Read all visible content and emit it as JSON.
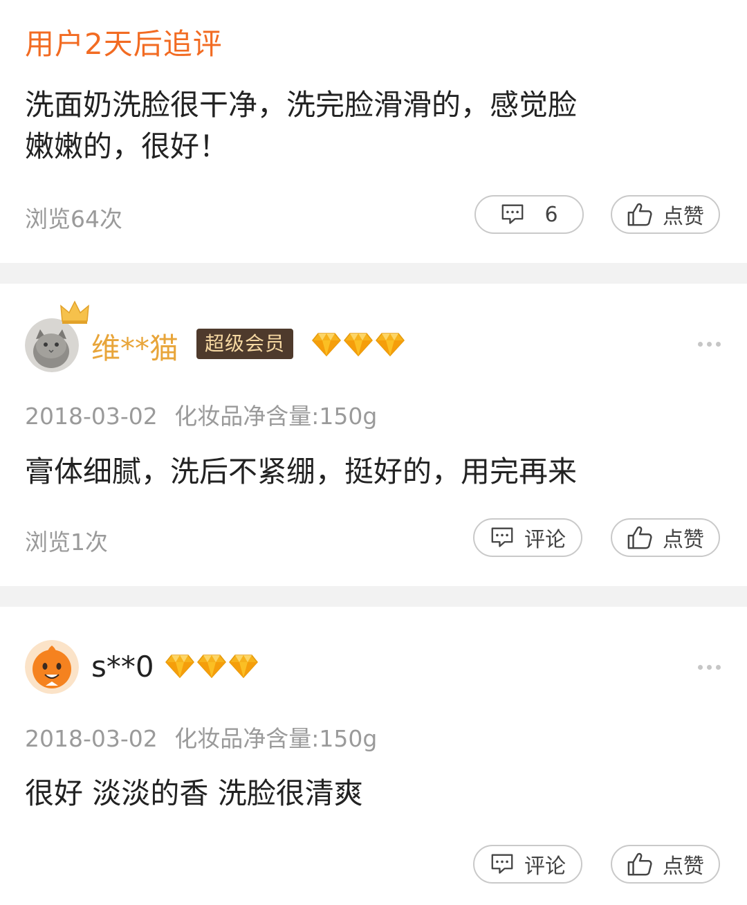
{
  "colors": {
    "accent": "#f26b22",
    "gold_name": "#e8a53a",
    "vip_bg": "#4e3a2c",
    "vip_text": "#f7d9a3",
    "muted": "#9a9a9a",
    "divider": "#f2f2f2"
  },
  "followup": {
    "title": "用户2天后追评",
    "content_line1": "洗面奶洗脸很干净，洗完脸滑滑的，感觉脸",
    "content_line2": "嫩嫩的，很好！",
    "views": "浏览64次",
    "comment_count": "6",
    "like_label": "点赞"
  },
  "reviews": [
    {
      "username": "维**猫",
      "badge": "超级会员",
      "diamond_count": 3,
      "date": "2018-03-02",
      "spec": "化妆品净含量:150g",
      "content": "膏体细腻，洗后不紧绷，挺好的，用完再来",
      "views": "浏览1次",
      "comment_label": "评论",
      "like_label": "点赞",
      "avatar_icon": "cat-avatar-with-crown"
    },
    {
      "username": "s**0",
      "diamond_count": 3,
      "date": "2018-03-02",
      "spec": "化妆品净含量:150g",
      "content": "很好 淡淡的香 洗脸很清爽",
      "comment_label": "评论",
      "like_label": "点赞",
      "avatar_icon": "orange-mascot-avatar"
    }
  ]
}
